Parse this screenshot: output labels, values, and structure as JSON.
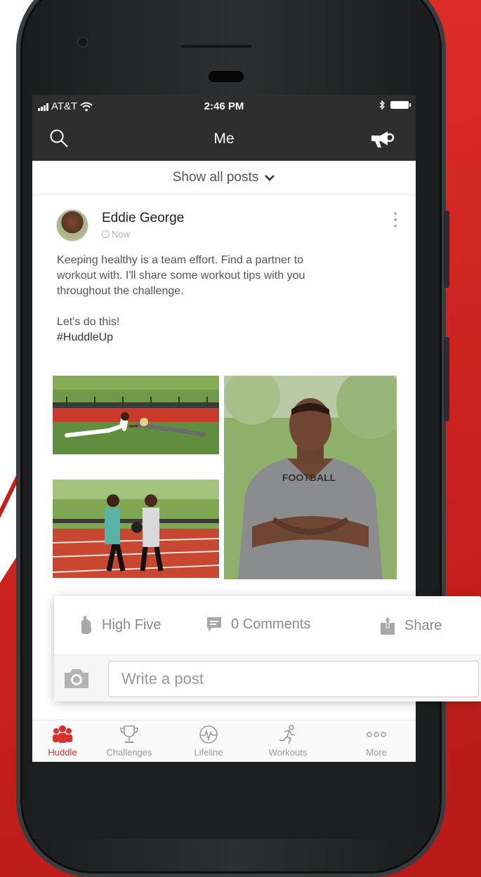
{
  "status_bar": {
    "carrier": "AT&T",
    "time": "2:46 PM"
  },
  "nav": {
    "title": "Me",
    "search_icon": "search-icon",
    "announce_icon": "megaphone-icon"
  },
  "filter": {
    "label": "Show all posts"
  },
  "post": {
    "author": "Eddie George",
    "time": "Now",
    "body_lines": [
      "Keeping healthy is a team effort. Find a partner to",
      "workout with. I'll share some workout tips with you",
      "throughout the challenge."
    ],
    "closing": "Let's do this!",
    "hashtag": "#HuddleUp"
  },
  "actions": {
    "high_five": "High Five",
    "comments": "0 Comments",
    "share": "Share"
  },
  "composer": {
    "placeholder": "Write a post"
  },
  "tabs": [
    {
      "label": "Huddle",
      "icon": "huddle-icon",
      "active": true
    },
    {
      "label": "Challenges",
      "icon": "trophy-icon",
      "active": false
    },
    {
      "label": "Lifeline",
      "icon": "heartbeat-icon",
      "active": false
    },
    {
      "label": "Workouts",
      "icon": "runner-icon",
      "active": false
    },
    {
      "label": "More",
      "icon": "more-icon",
      "active": false
    }
  ],
  "colors": {
    "accent": "#d9302c",
    "nav_bg": "#2d2d2d",
    "background_red": "#d32a27"
  }
}
